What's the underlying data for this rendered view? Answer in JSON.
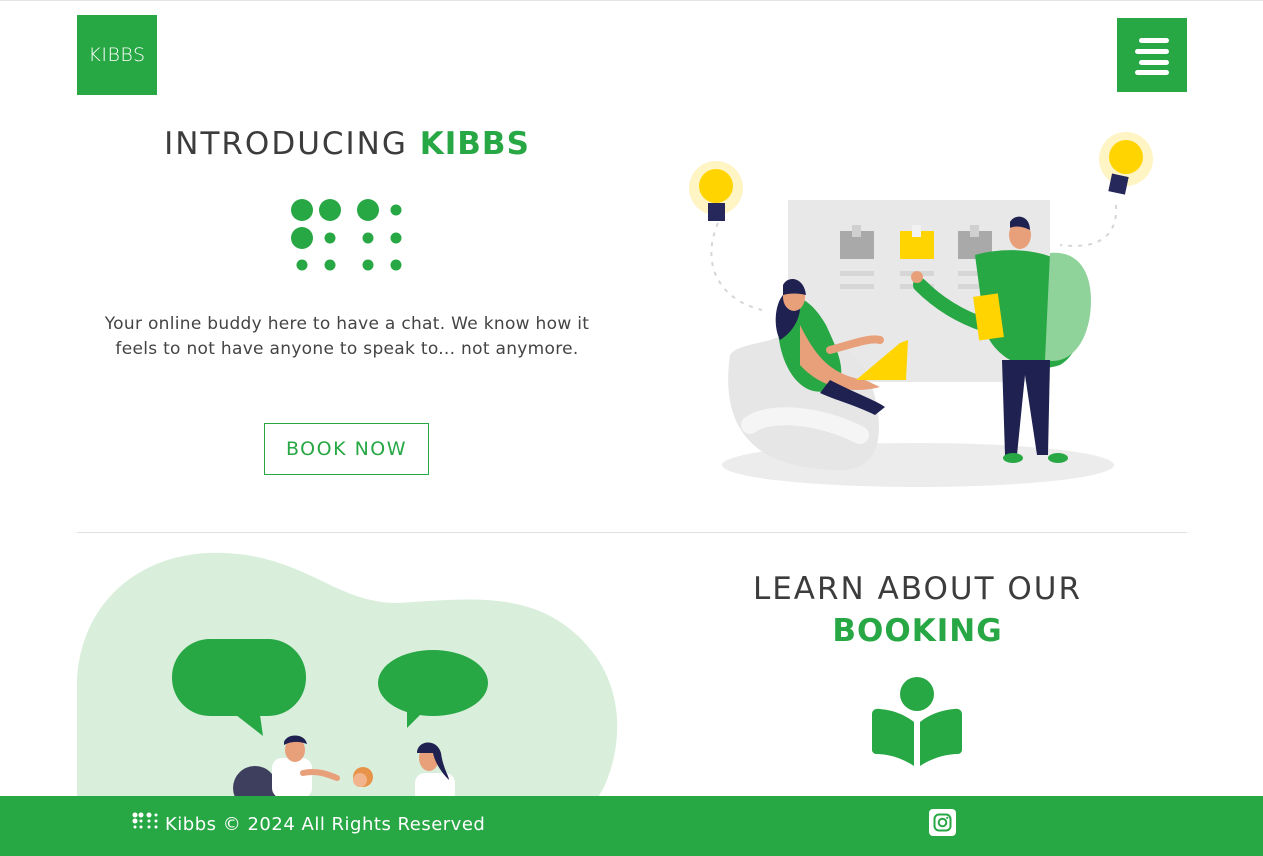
{
  "brand": {
    "logo_text": "KIBBS"
  },
  "header": {
    "menu_icon": "hamburger-menu-icon"
  },
  "hero": {
    "title_plain": "INTRODUCING",
    "title_accent": "KIBBS",
    "tagline": "Your online buddy here to have a chat. We know how it feels to not have anyone to speak to... not anymore.",
    "cta_label": "BOOK NOW",
    "icon": "braille-dots-icon"
  },
  "learn": {
    "title_plain": "LEARN ABOUT OUR",
    "title_accent": "BOOKING",
    "icon": "reader-book-icon"
  },
  "footer": {
    "copyright": "Kibbs © 2024 All Rights Reserved",
    "social_icon": "instagram-icon"
  },
  "colors": {
    "brand_green": "#28a745",
    "light_green": "#d9efdc",
    "text_dark": "#3c3c3c",
    "bulb_yellow": "#ffd400"
  }
}
